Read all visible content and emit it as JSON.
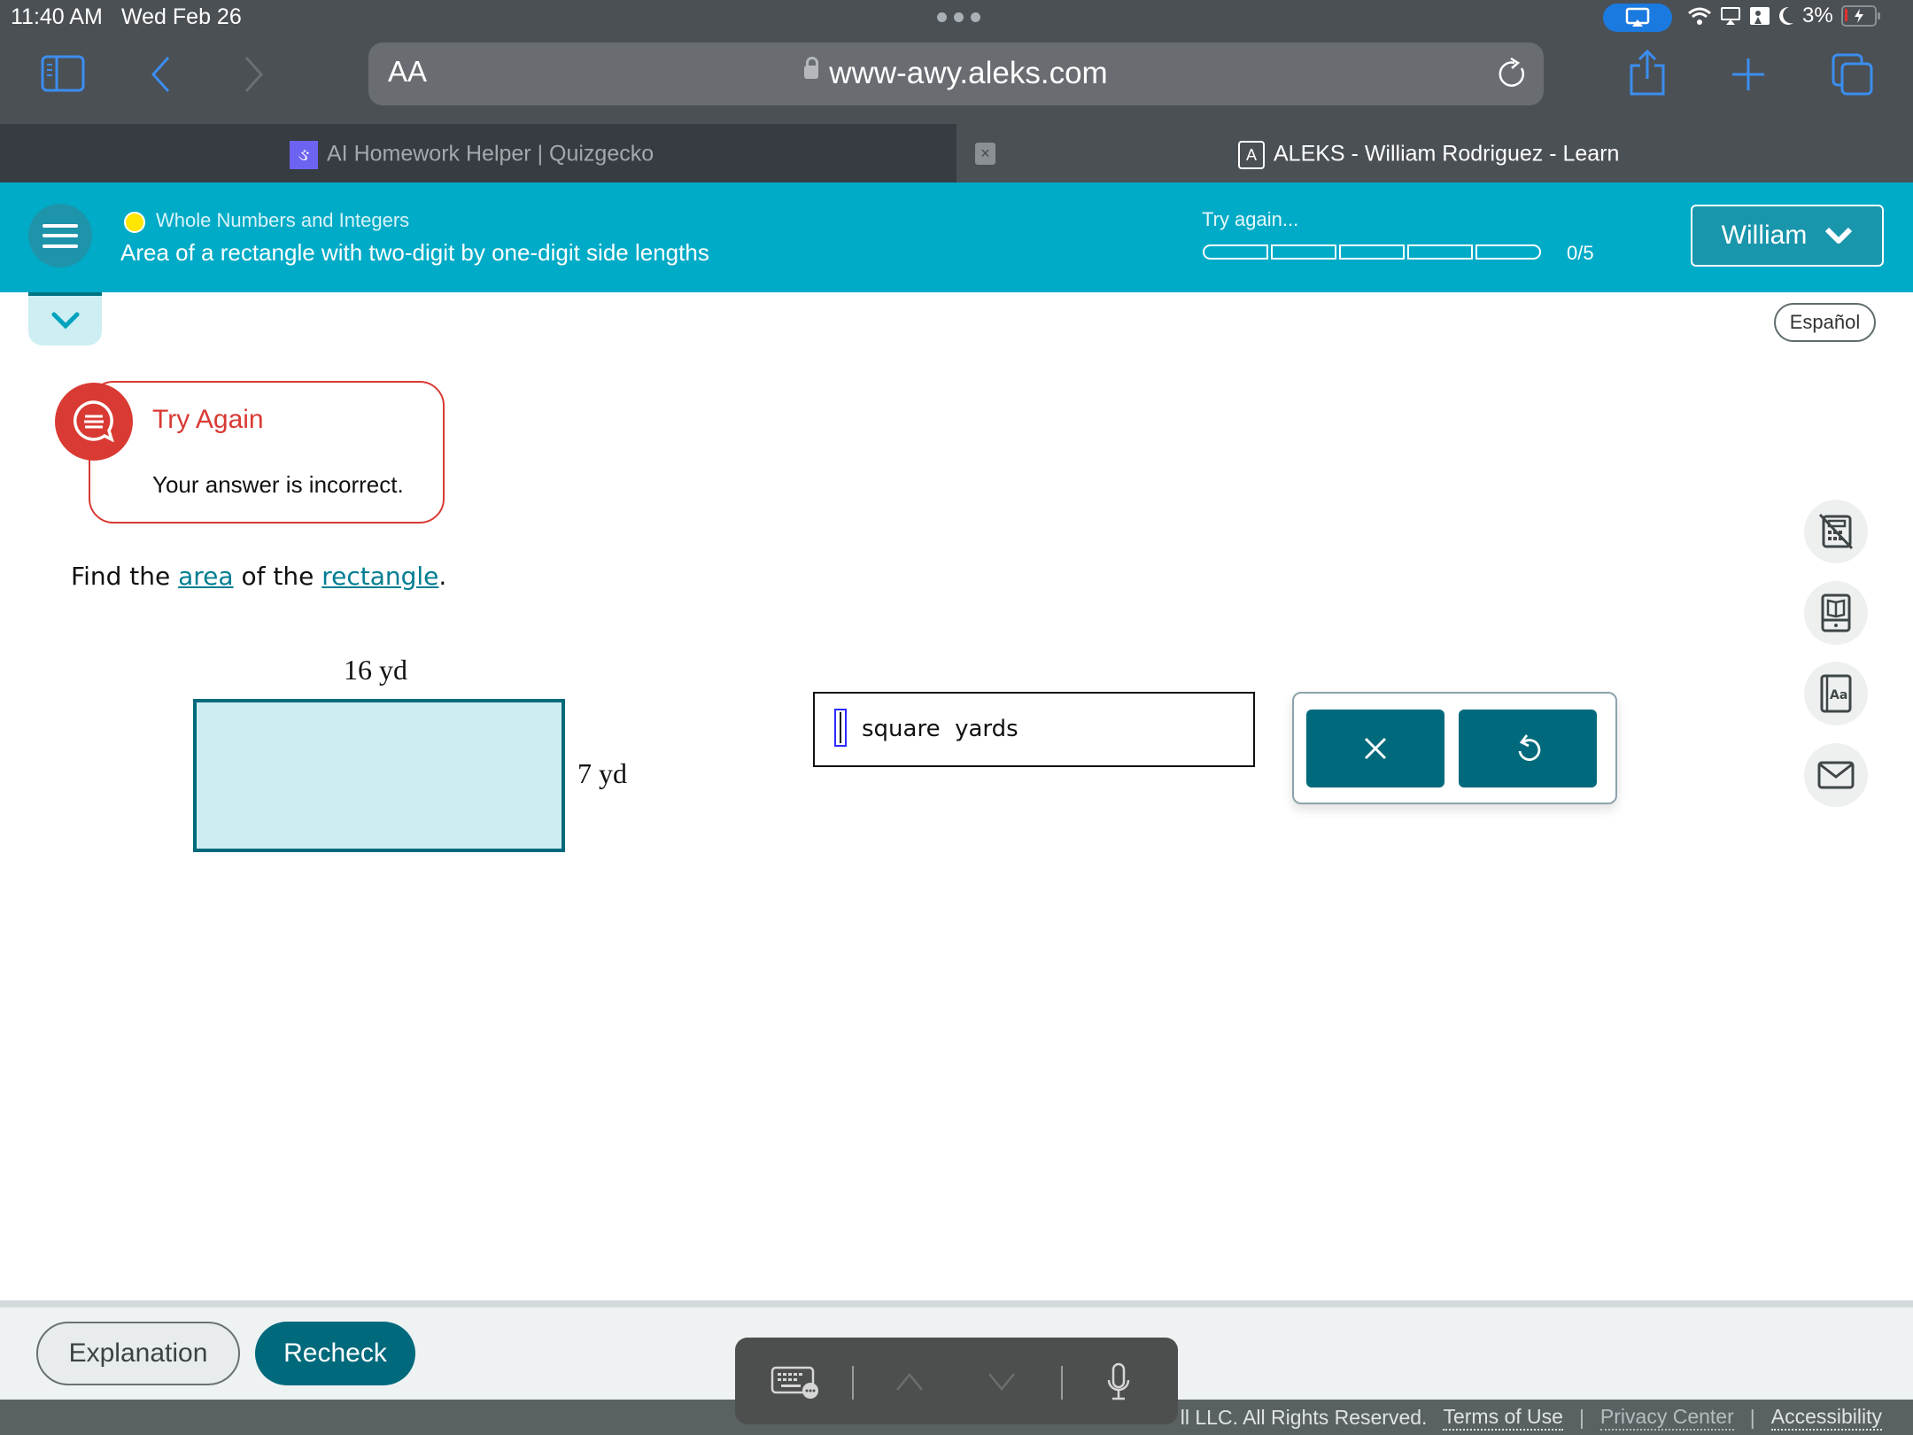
{
  "status_bar": {
    "time": "11:40 AM",
    "date": "Wed Feb 26",
    "battery": "3%",
    "icons": [
      "screen-mirroring-icon",
      "wifi-icon",
      "airplay-icon",
      "focus-icon",
      "moon-icon",
      "battery-charging-icon"
    ]
  },
  "browser": {
    "text_size_label": "AA",
    "url": "www-awy.aleks.com",
    "tabs": [
      {
        "label": "AI Homework Helper | Quizgecko",
        "favicon": "Q",
        "active": false
      },
      {
        "label": "ALEKS - William Rodriguez - Learn",
        "favicon": "A",
        "active": true
      }
    ],
    "tab_close": "×"
  },
  "header": {
    "topic": "Whole Numbers and Integers",
    "lesson_title": "Area of a rectangle with two-digit by one-digit side lengths",
    "progress_label": "Try again...",
    "progress": {
      "completed": 0,
      "total": 5,
      "text": "0/5"
    },
    "user_name": "William",
    "colors": {
      "header_bg": "#00abc7",
      "accent": "#006a7c",
      "topic_dot": "#ffe600",
      "error": "#d93a33"
    }
  },
  "language_toggle": "Español",
  "feedback": {
    "title": "Try Again",
    "message": "Your answer is incorrect."
  },
  "question": {
    "prefix": "Find the ",
    "link1": "area",
    "middle": " of the ",
    "link2": "rectangle",
    "suffix": ".",
    "figure": {
      "top_label": "16 yd",
      "side_label": "7 yd",
      "width_value": 16,
      "height_value": 7,
      "unit": "yd"
    },
    "answer": {
      "value": "",
      "unit_label": "square  yards"
    }
  },
  "answer_tools": {
    "clear_label": "×",
    "undo_label": "↺"
  },
  "side_tools": [
    {
      "name": "calculator-disabled-icon"
    },
    {
      "name": "ebook-icon"
    },
    {
      "name": "dictionary-icon"
    },
    {
      "name": "message-icon"
    }
  ],
  "bottom": {
    "explanation_label": "Explanation",
    "recheck_label": "Recheck"
  },
  "footer": {
    "copyright": "ll LLC. All Rights Reserved.",
    "terms": "Terms of Use",
    "privacy": "Privacy Center",
    "accessibility": "Accessibility",
    "separator": "|"
  }
}
